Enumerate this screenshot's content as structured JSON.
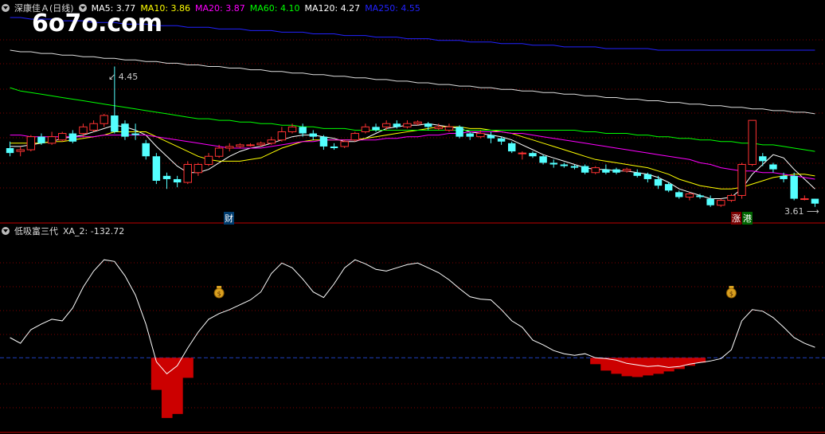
{
  "watermark": "6o7o.com",
  "main_panel": {
    "stock_name": "深康佳Ａ",
    "period": "(日线)",
    "ma": [
      {
        "label": "MA5: 3.77",
        "color": "#ffffff"
      },
      {
        "label": "MA10: 3.86",
        "color": "#ffff00"
      },
      {
        "label": "MA20: 3.87",
        "color": "#ff00ff"
      },
      {
        "label": "MA60: 4.10",
        "color": "#00ff00"
      },
      {
        "label": "MA120: 4.27",
        "color": "#ffffff"
      },
      {
        "label": "MA250: 4.55",
        "color": "#2222ff"
      }
    ],
    "high_label": "4.45",
    "low_label": "3.61",
    "marker_cai": "财",
    "marker_zhang": "涨",
    "marker_gang": "港"
  },
  "sub_panel": {
    "name": "低吸富三代",
    "value_label": "XA_2: -132.72"
  },
  "colors": {
    "up": "#ff3232",
    "down": "#54ffff",
    "grid": "#800000",
    "zero_line": "#2040c0",
    "bar": "#cc0000",
    "panel_border": "#c00000"
  },
  "chart_data": {
    "type": "candlestick",
    "y_range_price": [
      3.55,
      4.75
    ],
    "candles": [
      [
        3.95,
        3.92,
        3.99,
        3.9
      ],
      [
        3.93,
        3.94,
        3.96,
        3.9
      ],
      [
        3.94,
        4.02,
        4.03,
        3.93
      ],
      [
        4.02,
        3.98,
        4.04,
        3.97
      ],
      [
        3.98,
        4.02,
        4.05,
        3.97
      ],
      [
        4.0,
        4.04,
        4.05,
        3.99
      ],
      [
        4.04,
        3.99,
        4.06,
        3.98
      ],
      [
        4.04,
        4.08,
        4.1,
        4.02
      ],
      [
        4.06,
        4.1,
        4.12,
        4.05
      ],
      [
        4.1,
        4.15,
        4.16,
        4.08
      ],
      [
        4.15,
        4.05,
        4.45,
        4.04
      ],
      [
        4.1,
        4.02,
        4.12,
        4.0
      ],
      [
        4.04,
        4.03,
        4.1,
        4.0
      ],
      [
        3.98,
        3.9,
        4.0,
        3.88
      ],
      [
        3.9,
        3.75,
        3.92,
        3.73
      ],
      [
        3.78,
        3.76,
        3.8,
        3.7
      ],
      [
        3.76,
        3.74,
        3.78,
        3.71
      ],
      [
        3.74,
        3.85,
        3.87,
        3.73
      ],
      [
        3.8,
        3.85,
        3.86,
        3.78
      ],
      [
        3.85,
        3.9,
        3.92,
        3.84
      ],
      [
        3.9,
        3.95,
        3.97,
        3.89
      ],
      [
        3.95,
        3.96,
        3.98,
        3.93
      ],
      [
        3.96,
        3.97,
        3.98,
        3.95
      ],
      [
        3.97,
        3.97,
        3.98,
        3.96
      ],
      [
        3.97,
        3.98,
        3.99,
        3.96
      ],
      [
        3.98,
        4.0,
        4.02,
        3.97
      ],
      [
        4.0,
        4.05,
        4.08,
        3.99
      ],
      [
        4.05,
        4.08,
        4.1,
        4.04
      ],
      [
        4.08,
        4.04,
        4.1,
        4.02
      ],
      [
        4.04,
        4.02,
        4.06,
        4.0
      ],
      [
        4.02,
        3.96,
        4.03,
        3.94
      ],
      [
        3.96,
        3.95,
        3.98,
        3.94
      ],
      [
        3.96,
        3.99,
        4.0,
        3.95
      ],
      [
        4.0,
        4.04,
        4.05,
        3.99
      ],
      [
        4.05,
        4.08,
        4.1,
        4.04
      ],
      [
        4.08,
        4.06,
        4.1,
        4.05
      ],
      [
        4.08,
        4.1,
        4.12,
        4.06
      ],
      [
        4.1,
        4.08,
        4.12,
        4.07
      ],
      [
        4.08,
        4.1,
        4.12,
        4.07
      ],
      [
        4.1,
        4.11,
        4.12,
        4.09
      ],
      [
        4.1,
        4.08,
        4.11,
        4.06
      ],
      [
        4.07,
        4.08,
        4.1,
        4.06
      ],
      [
        4.06,
        4.08,
        4.1,
        4.05
      ],
      [
        4.08,
        4.02,
        4.09,
        4.01
      ],
      [
        4.04,
        4.02,
        4.05,
        4.0
      ],
      [
        4.02,
        4.04,
        4.06,
        4.01
      ],
      [
        4.03,
        4.01,
        4.05,
        3.98
      ],
      [
        4.01,
        3.99,
        4.02,
        3.97
      ],
      [
        3.98,
        3.93,
        3.99,
        3.92
      ],
      [
        3.92,
        3.92,
        3.93,
        3.88
      ],
      [
        3.92,
        3.9,
        3.93,
        3.89
      ],
      [
        3.9,
        3.86,
        3.91,
        3.85
      ],
      [
        3.86,
        3.85,
        3.88,
        3.83
      ],
      [
        3.85,
        3.84,
        3.86,
        3.83
      ],
      [
        3.84,
        3.83,
        3.85,
        3.82
      ],
      [
        3.84,
        3.8,
        3.85,
        3.79
      ],
      [
        3.8,
        3.83,
        3.84,
        3.79
      ],
      [
        3.82,
        3.8,
        3.85,
        3.79
      ],
      [
        3.82,
        3.8,
        3.83,
        3.79
      ],
      [
        3.81,
        3.82,
        3.83,
        3.8
      ],
      [
        3.8,
        3.78,
        3.82,
        3.77
      ],
      [
        3.79,
        3.76,
        3.8,
        3.74
      ],
      [
        3.76,
        3.72,
        3.78,
        3.7
      ],
      [
        3.73,
        3.69,
        3.74,
        3.68
      ],
      [
        3.68,
        3.65,
        3.69,
        3.64
      ],
      [
        3.65,
        3.67,
        3.68,
        3.63
      ],
      [
        3.66,
        3.65,
        3.67,
        3.64
      ],
      [
        3.64,
        3.6,
        3.66,
        3.59
      ],
      [
        3.6,
        3.63,
        3.64,
        3.59
      ],
      [
        3.63,
        3.66,
        3.67,
        3.62
      ],
      [
        3.66,
        3.85,
        3.86,
        3.64
      ],
      [
        3.85,
        4.12,
        4.12,
        3.84
      ],
      [
        3.9,
        3.87,
        3.92,
        3.84
      ],
      [
        3.85,
        3.82,
        3.86,
        3.8
      ],
      [
        3.78,
        3.76,
        3.8,
        3.74
      ],
      [
        3.78,
        3.64,
        3.8,
        3.63
      ],
      [
        3.64,
        3.64,
        3.66,
        3.63
      ],
      [
        3.64,
        3.61,
        3.64,
        3.59
      ]
    ],
    "ma_series": [
      {
        "name": "MA5",
        "color": "#ffffff",
        "values": [
          3.96,
          3.96,
          3.97,
          3.98,
          3.99,
          4.01,
          4.02,
          4.03,
          4.05,
          4.07,
          4.09,
          4.08,
          4.06,
          4.03,
          3.96,
          3.9,
          3.84,
          3.8,
          3.8,
          3.82,
          3.86,
          3.9,
          3.93,
          3.95,
          3.96,
          3.98,
          4.0,
          4.02,
          4.03,
          4.03,
          4.02,
          4.01,
          3.99,
          3.99,
          4.01,
          4.04,
          4.07,
          4.08,
          4.09,
          4.09,
          4.1,
          4.09,
          4.08,
          4.07,
          4.05,
          4.04,
          4.03,
          4.02,
          4.0,
          3.97,
          3.94,
          3.91,
          3.89,
          3.87,
          3.85,
          3.83,
          3.82,
          3.82,
          3.81,
          3.81,
          3.8,
          3.79,
          3.77,
          3.74,
          3.7,
          3.68,
          3.66,
          3.64,
          3.64,
          3.65,
          3.7,
          3.79,
          3.85,
          3.91,
          3.89,
          3.82,
          3.76,
          3.7
        ]
      },
      {
        "name": "MA10",
        "color": "#ffff00",
        "values": [
          3.98,
          3.98,
          3.98,
          3.98,
          3.99,
          3.99,
          4.0,
          4.01,
          4.02,
          4.03,
          4.05,
          4.05,
          4.05,
          4.05,
          4.02,
          3.99,
          3.96,
          3.93,
          3.9,
          3.88,
          3.87,
          3.87,
          3.87,
          3.88,
          3.89,
          3.92,
          3.95,
          3.97,
          3.99,
          4.0,
          4.0,
          4.0,
          4.0,
          4.0,
          4.01,
          4.02,
          4.03,
          4.04,
          4.05,
          4.06,
          4.07,
          4.08,
          4.08,
          4.08,
          4.07,
          4.07,
          4.06,
          4.05,
          4.04,
          4.02,
          4.0,
          3.98,
          3.96,
          3.94,
          3.92,
          3.9,
          3.88,
          3.87,
          3.86,
          3.85,
          3.84,
          3.83,
          3.81,
          3.79,
          3.76,
          3.74,
          3.72,
          3.71,
          3.7,
          3.7,
          3.71,
          3.73,
          3.75,
          3.77,
          3.78,
          3.79,
          3.79,
          3.78
        ]
      },
      {
        "name": "MA20",
        "color": "#ff00ff",
        "values": [
          4.03,
          4.03,
          4.02,
          4.02,
          4.02,
          4.02,
          4.02,
          4.02,
          4.02,
          4.03,
          4.03,
          4.03,
          4.03,
          4.03,
          4.02,
          4.01,
          4.0,
          3.99,
          3.98,
          3.97,
          3.96,
          3.95,
          3.95,
          3.95,
          3.95,
          3.96,
          3.97,
          3.98,
          3.99,
          3.99,
          4.0,
          4.0,
          4.0,
          4.0,
          4.0,
          4.0,
          4.01,
          4.01,
          4.02,
          4.02,
          4.03,
          4.03,
          4.04,
          4.04,
          4.05,
          4.05,
          4.05,
          4.05,
          4.04,
          4.04,
          4.03,
          4.02,
          4.01,
          4.0,
          3.99,
          3.98,
          3.97,
          3.96,
          3.95,
          3.94,
          3.93,
          3.92,
          3.91,
          3.9,
          3.89,
          3.88,
          3.86,
          3.85,
          3.83,
          3.82,
          3.81,
          3.81,
          3.8,
          3.8,
          3.79,
          3.78,
          3.77,
          3.76
        ]
      },
      {
        "name": "MA60",
        "color": "#00ff00",
        "values": [
          4.32,
          4.3,
          4.29,
          4.28,
          4.27,
          4.26,
          4.25,
          4.24,
          4.23,
          4.22,
          4.21,
          4.2,
          4.19,
          4.18,
          4.17,
          4.16,
          4.15,
          4.14,
          4.13,
          4.13,
          4.12,
          4.12,
          4.11,
          4.11,
          4.1,
          4.1,
          4.09,
          4.09,
          4.08,
          4.08,
          4.07,
          4.07,
          4.07,
          4.06,
          4.06,
          4.06,
          4.06,
          4.06,
          4.06,
          4.06,
          4.06,
          4.06,
          4.06,
          4.06,
          4.06,
          4.06,
          4.06,
          4.06,
          4.06,
          4.06,
          4.06,
          4.06,
          4.06,
          4.06,
          4.06,
          4.05,
          4.05,
          4.04,
          4.04,
          4.04,
          4.03,
          4.03,
          4.02,
          4.02,
          4.01,
          4.01,
          4.0,
          4.0,
          3.99,
          3.99,
          3.98,
          3.98,
          3.97,
          3.97,
          3.96,
          3.95,
          3.94,
          3.93
        ]
      },
      {
        "name": "MA120",
        "color": "#dddddd",
        "values": [
          4.55,
          4.54,
          4.54,
          4.53,
          4.53,
          4.52,
          4.52,
          4.51,
          4.51,
          4.5,
          4.5,
          4.49,
          4.49,
          4.48,
          4.48,
          4.47,
          4.47,
          4.46,
          4.46,
          4.45,
          4.45,
          4.44,
          4.44,
          4.43,
          4.43,
          4.42,
          4.42,
          4.41,
          4.41,
          4.4,
          4.4,
          4.39,
          4.39,
          4.38,
          4.38,
          4.37,
          4.37,
          4.36,
          4.36,
          4.35,
          4.35,
          4.34,
          4.34,
          4.33,
          4.33,
          4.32,
          4.32,
          4.31,
          4.31,
          4.3,
          4.3,
          4.29,
          4.29,
          4.28,
          4.28,
          4.27,
          4.27,
          4.26,
          4.26,
          4.25,
          4.25,
          4.24,
          4.24,
          4.23,
          4.23,
          4.22,
          4.22,
          4.21,
          4.21,
          4.2,
          4.2,
          4.19,
          4.19,
          4.18,
          4.18,
          4.17,
          4.17,
          4.16
        ]
      },
      {
        "name": "MA250",
        "color": "#2222ff",
        "values": [
          4.75,
          4.75,
          4.74,
          4.74,
          4.74,
          4.73,
          4.73,
          4.73,
          4.72,
          4.72,
          4.72,
          4.71,
          4.71,
          4.71,
          4.7,
          4.7,
          4.7,
          4.69,
          4.69,
          4.69,
          4.68,
          4.68,
          4.68,
          4.67,
          4.67,
          4.67,
          4.66,
          4.66,
          4.66,
          4.65,
          4.65,
          4.65,
          4.64,
          4.64,
          4.64,
          4.63,
          4.63,
          4.63,
          4.62,
          4.62,
          4.62,
          4.61,
          4.61,
          4.61,
          4.6,
          4.6,
          4.6,
          4.59,
          4.59,
          4.59,
          4.58,
          4.58,
          4.58,
          4.57,
          4.57,
          4.57,
          4.57,
          4.56,
          4.56,
          4.56,
          4.56,
          4.56,
          4.55,
          4.55,
          4.55,
          4.55,
          4.55,
          4.55,
          4.55,
          4.55,
          4.55,
          4.55,
          4.55,
          4.55,
          4.55,
          4.55,
          4.55,
          4.55
        ]
      }
    ],
    "indicator": {
      "y_range": [
        -90,
        150
      ],
      "line": [
        25,
        18,
        35,
        42,
        48,
        46,
        62,
        88,
        108,
        122,
        120,
        102,
        78,
        42,
        -5,
        -20,
        -10,
        12,
        32,
        48,
        55,
        60,
        66,
        72,
        82,
        105,
        118,
        112,
        98,
        82,
        75,
        92,
        112,
        122,
        117,
        110,
        108,
        112,
        116,
        118,
        112,
        106,
        97,
        86,
        76,
        73,
        72,
        60,
        46,
        38,
        22,
        16,
        9,
        5,
        3,
        5,
        0,
        -1,
        -3,
        -7,
        -9,
        -11,
        -10,
        -12,
        -11,
        -8,
        -6,
        -4,
        -1,
        10,
        46,
        60,
        58,
        50,
        38,
        25,
        18,
        13
      ],
      "bars": [
        0,
        0,
        0,
        0,
        0,
        0,
        0,
        0,
        0,
        0,
        0,
        0,
        0,
        0,
        -40,
        -75,
        -70,
        -25,
        0,
        0,
        0,
        0,
        0,
        0,
        0,
        0,
        0,
        0,
        0,
        0,
        0,
        0,
        0,
        0,
        0,
        0,
        0,
        0,
        0,
        0,
        0,
        0,
        0,
        0,
        0,
        0,
        0,
        0,
        0,
        0,
        0,
        0,
        0,
        0,
        0,
        0,
        -8,
        -16,
        -20,
        -23,
        -24,
        -22,
        -20,
        -17,
        -14,
        -10,
        -6,
        0,
        0,
        0,
        0,
        0,
        0,
        0,
        0,
        0,
        0,
        0
      ],
      "signal_indices": [
        20,
        69
      ]
    }
  }
}
